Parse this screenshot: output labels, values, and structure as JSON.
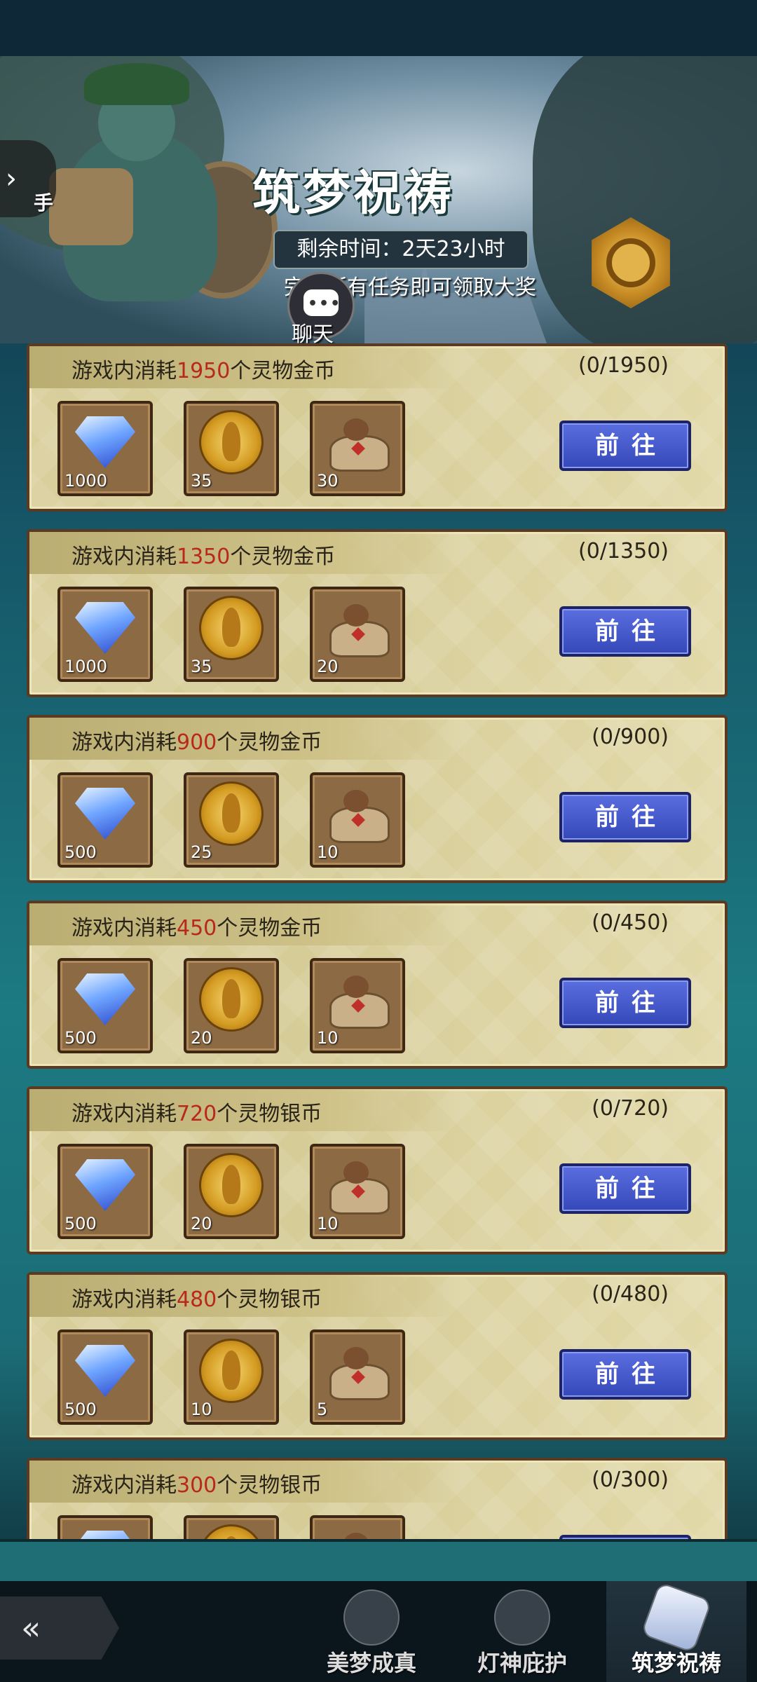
{
  "banner": {
    "title": "筑梦祝祷",
    "timer": "剩余时间：2天23小时",
    "tip": "完成所有任务即可领取大奖",
    "side_button_label": "手",
    "chat_label": "聊天"
  },
  "go_label": "前往",
  "tasks": [
    {
      "prefix": "游戏内消耗",
      "num": "1950",
      "suffix": "个灵物金币",
      "progress": "(0/1950)",
      "rewards": [
        "1000",
        "35",
        "30"
      ]
    },
    {
      "prefix": "游戏内消耗",
      "num": "1350",
      "suffix": "个灵物金币",
      "progress": "(0/1350)",
      "rewards": [
        "1000",
        "35",
        "20"
      ]
    },
    {
      "prefix": "游戏内消耗",
      "num": "900",
      "suffix": "个灵物金币",
      "progress": "(0/900)",
      "rewards": [
        "500",
        "25",
        "10"
      ]
    },
    {
      "prefix": "游戏内消耗",
      "num": "450",
      "suffix": "个灵物金币",
      "progress": "(0/450)",
      "rewards": [
        "500",
        "20",
        "10"
      ]
    },
    {
      "prefix": "游戏内消耗",
      "num": "720",
      "suffix": "个灵物银币",
      "progress": "(0/720)",
      "rewards": [
        "500",
        "20",
        "10"
      ]
    },
    {
      "prefix": "游戏内消耗",
      "num": "480",
      "suffix": "个灵物银币",
      "progress": "(0/480)",
      "rewards": [
        "500",
        "10",
        "5"
      ]
    },
    {
      "prefix": "游戏内消耗",
      "num": "300",
      "suffix": "个灵物银币",
      "progress": "(0/300)",
      "rewards": [
        "",
        "",
        ""
      ]
    }
  ],
  "reward_icons": [
    "gem-icon",
    "gold-token-icon",
    "magic-lamp-icon"
  ],
  "nav": {
    "items": [
      {
        "label": "美梦成真",
        "icon": "dream-icon"
      },
      {
        "label": "灯神庇护",
        "icon": "genie-icon"
      },
      {
        "label": "筑梦祝祷",
        "icon": "crystal-icon",
        "active": true
      }
    ]
  },
  "colors": {
    "accent_red": "#b8281e",
    "button_blue": "#3548b8",
    "card_bg": "#d9cf9c"
  }
}
